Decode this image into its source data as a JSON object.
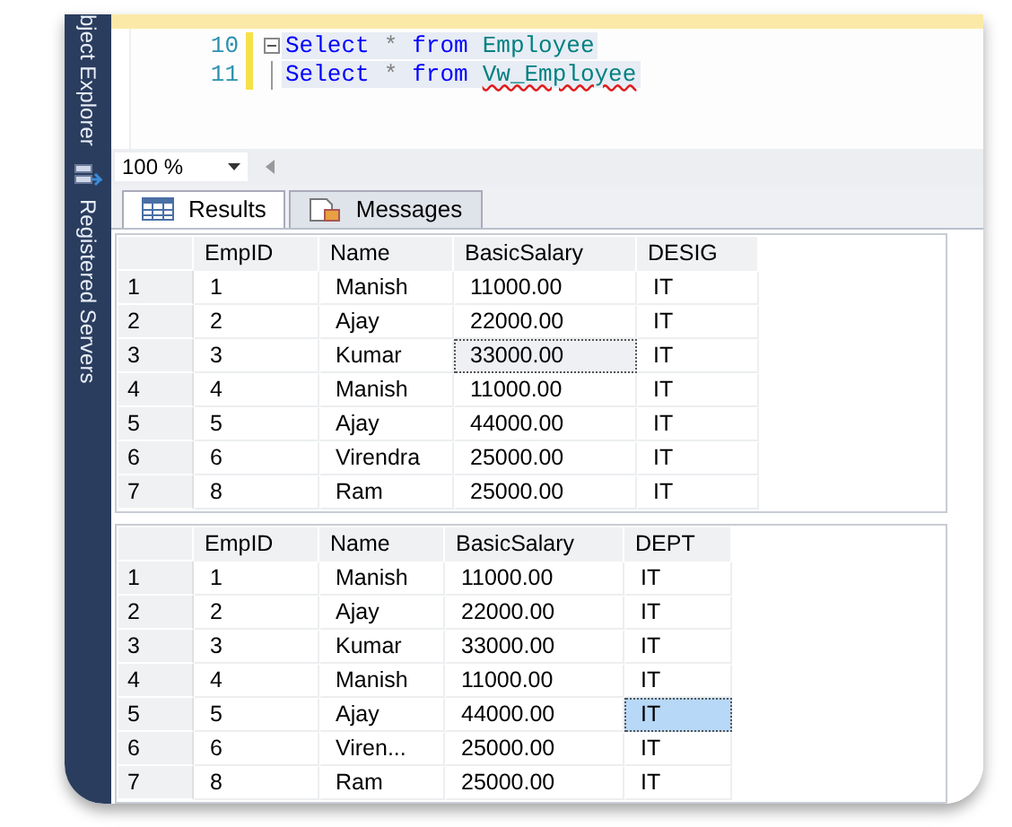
{
  "sidebar": {
    "items": [
      {
        "label": "bject Explorer"
      },
      {
        "label": "Registered Servers"
      }
    ]
  },
  "editor": {
    "lines": [
      {
        "number": "10",
        "collapsible": true,
        "tokens": [
          {
            "kind": "keyword",
            "text": "Select"
          },
          {
            "kind": "operator",
            "text": "*"
          },
          {
            "kind": "keyword",
            "text": "from"
          },
          {
            "kind": "object",
            "text": "Employee"
          }
        ]
      },
      {
        "number": "11",
        "collapsible": false,
        "tokens": [
          {
            "kind": "keyword",
            "text": "Select"
          },
          {
            "kind": "operator",
            "text": "*"
          },
          {
            "kind": "keyword",
            "text": "from"
          },
          {
            "kind": "error",
            "text": "Vw_Employee"
          }
        ]
      }
    ]
  },
  "zoom": {
    "value": "100 %"
  },
  "tabs": [
    {
      "label": "Results",
      "selected": true
    },
    {
      "label": "Messages",
      "selected": false
    }
  ],
  "grids": [
    {
      "columns": [
        "EmpID",
        "Name",
        "BasicSalary",
        "DESIG"
      ],
      "rows": [
        {
          "number": "1",
          "cells": [
            {
              "text": "1",
              "focused": false,
              "selected": false
            },
            {
              "text": "Manish",
              "focused": false,
              "selected": false
            },
            {
              "text": "11000.00",
              "focused": false,
              "selected": false
            },
            {
              "text": "IT",
              "focused": false,
              "selected": false
            }
          ]
        },
        {
          "number": "2",
          "cells": [
            {
              "text": "2",
              "focused": false,
              "selected": false
            },
            {
              "text": "Ajay",
              "focused": false,
              "selected": false
            },
            {
              "text": "22000.00",
              "focused": false,
              "selected": false
            },
            {
              "text": "IT",
              "focused": false,
              "selected": false
            }
          ]
        },
        {
          "number": "3",
          "cells": [
            {
              "text": "3",
              "focused": false,
              "selected": false
            },
            {
              "text": "Kumar",
              "focused": false,
              "selected": false
            },
            {
              "text": "33000.00",
              "focused": true,
              "selected": false
            },
            {
              "text": "IT",
              "focused": false,
              "selected": false
            }
          ]
        },
        {
          "number": "4",
          "cells": [
            {
              "text": "4",
              "focused": false,
              "selected": false
            },
            {
              "text": "Manish",
              "focused": false,
              "selected": false
            },
            {
              "text": "11000.00",
              "focused": false,
              "selected": false
            },
            {
              "text": "IT",
              "focused": false,
              "selected": false
            }
          ]
        },
        {
          "number": "5",
          "cells": [
            {
              "text": "5",
              "focused": false,
              "selected": false
            },
            {
              "text": "Ajay",
              "focused": false,
              "selected": false
            },
            {
              "text": "44000.00",
              "focused": false,
              "selected": false
            },
            {
              "text": "IT",
              "focused": false,
              "selected": false
            }
          ]
        },
        {
          "number": "6",
          "cells": [
            {
              "text": "6",
              "focused": false,
              "selected": false
            },
            {
              "text": "Virendra",
              "focused": false,
              "selected": false
            },
            {
              "text": "25000.00",
              "focused": false,
              "selected": false
            },
            {
              "text": "IT",
              "focused": false,
              "selected": false
            }
          ]
        },
        {
          "number": "7",
          "cells": [
            {
              "text": "8",
              "focused": false,
              "selected": false
            },
            {
              "text": "Ram",
              "focused": false,
              "selected": false
            },
            {
              "text": "25000.00",
              "focused": false,
              "selected": false
            },
            {
              "text": "IT",
              "focused": false,
              "selected": false
            }
          ]
        }
      ]
    },
    {
      "columns": [
        "EmpID",
        "Name",
        "BasicSalary",
        "DEPT"
      ],
      "rows": [
        {
          "number": "1",
          "cells": [
            {
              "text": "1",
              "focused": false,
              "selected": false
            },
            {
              "text": "Manish",
              "focused": false,
              "selected": false
            },
            {
              "text": "11000.00",
              "focused": false,
              "selected": false
            },
            {
              "text": "IT",
              "focused": false,
              "selected": false
            }
          ]
        },
        {
          "number": "2",
          "cells": [
            {
              "text": "2",
              "focused": false,
              "selected": false
            },
            {
              "text": "Ajay",
              "focused": false,
              "selected": false
            },
            {
              "text": "22000.00",
              "focused": false,
              "selected": false
            },
            {
              "text": "IT",
              "focused": false,
              "selected": false
            }
          ]
        },
        {
          "number": "3",
          "cells": [
            {
              "text": "3",
              "focused": false,
              "selected": false
            },
            {
              "text": "Kumar",
              "focused": false,
              "selected": false
            },
            {
              "text": "33000.00",
              "focused": false,
              "selected": false
            },
            {
              "text": "IT",
              "focused": false,
              "selected": false
            }
          ]
        },
        {
          "number": "4",
          "cells": [
            {
              "text": "4",
              "focused": false,
              "selected": false
            },
            {
              "text": "Manish",
              "focused": false,
              "selected": false
            },
            {
              "text": "11000.00",
              "focused": false,
              "selected": false
            },
            {
              "text": "IT",
              "focused": false,
              "selected": false
            }
          ]
        },
        {
          "number": "5",
          "cells": [
            {
              "text": "5",
              "focused": false,
              "selected": false
            },
            {
              "text": "Ajay",
              "focused": false,
              "selected": false
            },
            {
              "text": "44000.00",
              "focused": false,
              "selected": false
            },
            {
              "text": "IT",
              "focused": true,
              "selected": true
            }
          ]
        },
        {
          "number": "6",
          "cells": [
            {
              "text": "6",
              "focused": false,
              "selected": false
            },
            {
              "text": "Viren...",
              "focused": false,
              "selected": false
            },
            {
              "text": "25000.00",
              "focused": false,
              "selected": false
            },
            {
              "text": "IT",
              "focused": false,
              "selected": false
            }
          ]
        },
        {
          "number": "7",
          "cells": [
            {
              "text": "8",
              "focused": false,
              "selected": false
            },
            {
              "text": "Ram",
              "focused": false,
              "selected": false
            },
            {
              "text": "25000.00",
              "focused": false,
              "selected": false
            },
            {
              "text": "IT",
              "focused": false,
              "selected": false
            }
          ]
        }
      ]
    }
  ]
}
